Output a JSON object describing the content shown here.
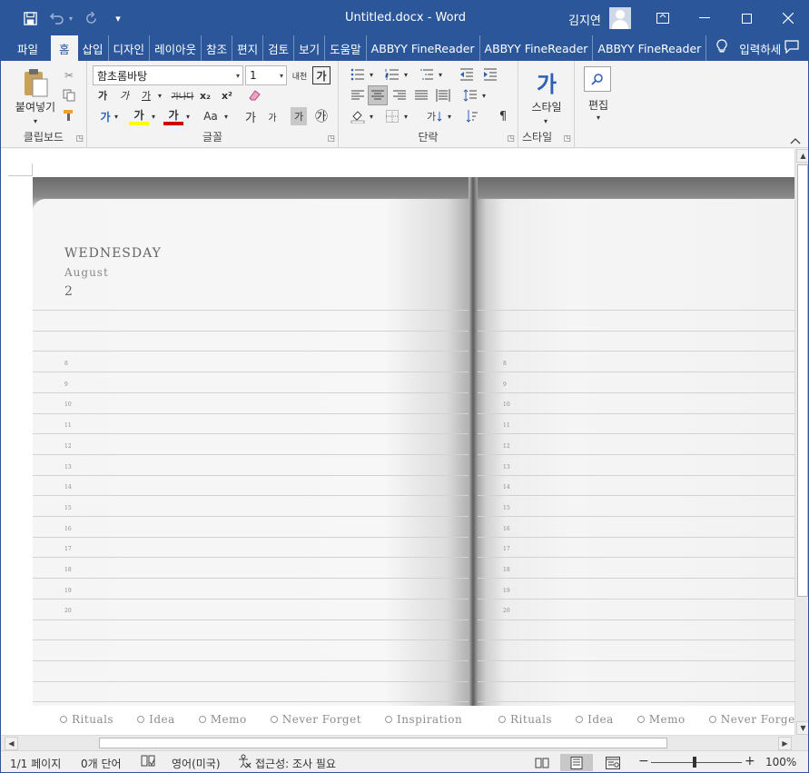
{
  "window": {
    "title": "Untitled.docx  -  Word",
    "user_name": "김지연"
  },
  "quick_access": {
    "save_icon": "save-icon",
    "undo_icon": "undo-icon",
    "redo_icon": "redo-icon",
    "customize_icon": "customize-icon"
  },
  "tabs": [
    {
      "label": "파일"
    },
    {
      "label": "홈"
    },
    {
      "label": "삽입"
    },
    {
      "label": "디자인"
    },
    {
      "label": "레이아웃"
    },
    {
      "label": "참조"
    },
    {
      "label": "편지"
    },
    {
      "label": "검토"
    },
    {
      "label": "보기"
    },
    {
      "label": "도움말"
    },
    {
      "label": "ABBYY FineReader"
    },
    {
      "label": "ABBYY FineReader"
    },
    {
      "label": "ABBYY FineReader"
    }
  ],
  "tell_me": "입력하세",
  "ribbon": {
    "clipboard": {
      "label": "클립보드",
      "paste_label": "붙여넣기"
    },
    "font": {
      "label": "글꼴",
      "font_name": "함초롬바탕",
      "font_size": "1",
      "bold": "가",
      "italic": "가",
      "underline": "가",
      "strike": "가나다",
      "subscript": "x₂",
      "superscript": "x²",
      "grow": "가",
      "shrink": "가",
      "case": "Aa",
      "char_shade": "가",
      "enclose": "㉮",
      "phonetic": "내천",
      "char_border": "가"
    },
    "paragraph": {
      "label": "단락"
    },
    "styles": {
      "label": "스타일",
      "button_label": "스타일",
      "glyph": "가"
    },
    "editing": {
      "label": "편집",
      "button_label": "편집"
    }
  },
  "document": {
    "day": "WEDNESDAY",
    "month": "August",
    "date": "2",
    "hours_left": [
      "8",
      "9",
      "10",
      "11",
      "12",
      "13",
      "14",
      "15",
      "16",
      "17",
      "18",
      "19",
      "20"
    ],
    "hours_right": [
      "8",
      "9",
      "10",
      "11",
      "12",
      "13",
      "14",
      "15",
      "16",
      "17",
      "18",
      "19",
      "20"
    ],
    "tags_left": [
      "Rituals",
      "Idea",
      "Memo",
      "Never Forget",
      "Inspiration"
    ],
    "tags_right": [
      "Rituals",
      "Idea",
      "Memo",
      "Never Forget"
    ]
  },
  "status": {
    "page": "1/1 페이지",
    "words": "0개 단어",
    "language": "영어(미국)",
    "accessibility": "접근성: 조사 필요",
    "zoom": "100%",
    "zoom_minus": "−",
    "zoom_plus": "+"
  }
}
